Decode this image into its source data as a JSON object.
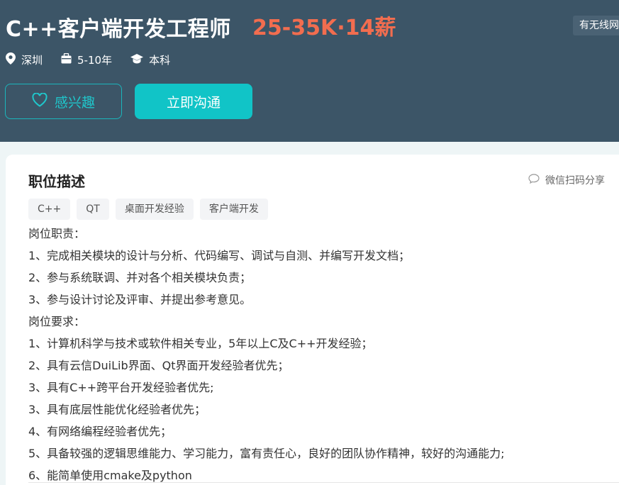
{
  "job": {
    "title": "C++客户端开发工程师",
    "salary": "25-35K·14薪",
    "corner_tag": "有无线网"
  },
  "meta": {
    "location": "深圳",
    "experience": "5-10年",
    "education": "本科"
  },
  "actions": {
    "interest_label": "感兴趣",
    "chat_label": "立即沟通"
  },
  "section": {
    "title": "职位描述",
    "share_label": "微信扫码分享"
  },
  "tags": [
    "C++",
    "QT",
    "桌面开发经验",
    "客户端开发"
  ],
  "description": [
    "岗位职责：",
    "1、完成相关模块的设计与分析、代码编写、调试与自测、并编写开发文档；",
    "2、参与系统联调、并对各个相关模块负责；",
    "3、参与设计讨论及评审、并提出参考意见。",
    "岗位要求：",
    "1、计算机科学与技术或软件相关专业，5年以上C及C++开发经验；",
    "2、具有云信DuiLib界面、Qt界面开发经验者优先；",
    "3、具有C++跨平台开发经验者优先;",
    "3、具有底层性能优化经验者优先；",
    "4、有网络编程经验者优先；",
    "5、具备较强的逻辑思维能力、学习能力，富有责任心，良好的团队协作精神，较好的沟通能力;",
    "6、能简单使用cmake及python"
  ],
  "colors": {
    "header_bg": "#3c5567",
    "salary": "#f26d4f",
    "accent": "#11c4c7"
  }
}
